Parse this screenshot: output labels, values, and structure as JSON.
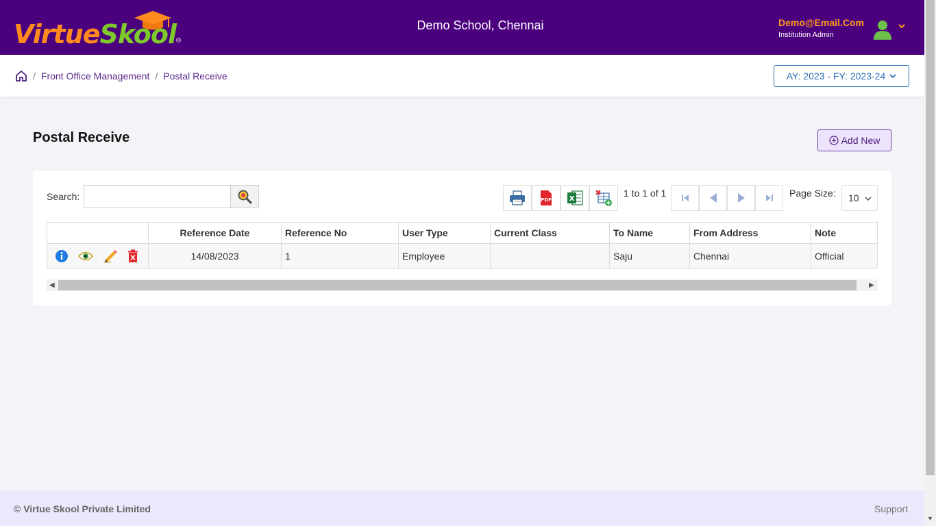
{
  "brand": {
    "logo_part1": "Virtue",
    "logo_part2": "Skool",
    "logo_reg": "®",
    "colors": {
      "header": "#4b007d",
      "virtue": "#ff8a1e",
      "skool": "#7ec92c"
    }
  },
  "header": {
    "school_name": "Demo School, Chennai",
    "user_email": "Demo@Email.Com",
    "user_role": "Institution Admin"
  },
  "breadcrumb": {
    "items": [
      "Front Office Management",
      "Postal Receive"
    ],
    "separator": "/"
  },
  "year_selector": {
    "value": "AY: 2023 - FY: 2023-24"
  },
  "page": {
    "title": "Postal Receive",
    "add_label": "Add New"
  },
  "toolbar": {
    "search_label": "Search:",
    "search_value": "",
    "pager_text": "1 to 1 of 1",
    "page_size_label": "Page Size:",
    "page_size": "10",
    "icons": [
      "print-icon",
      "pdf-icon",
      "excel-icon",
      "export-table-icon"
    ]
  },
  "table": {
    "columns": [
      "",
      "Reference Date",
      "Reference No",
      "User Type",
      "Current Class",
      "To Name",
      "From Address",
      "Note"
    ],
    "rows": [
      {
        "reference_date": "14/08/2023",
        "reference_no": "1",
        "user_type": "Employee",
        "current_class": "",
        "to_name": "Saju",
        "from_address": "Chennai",
        "note": "Official"
      }
    ],
    "row_actions": [
      "info-icon",
      "view-icon",
      "edit-icon",
      "delete-icon"
    ]
  },
  "footer": {
    "copyright": "© Virtue Skool Private Limited",
    "support": "Support"
  }
}
